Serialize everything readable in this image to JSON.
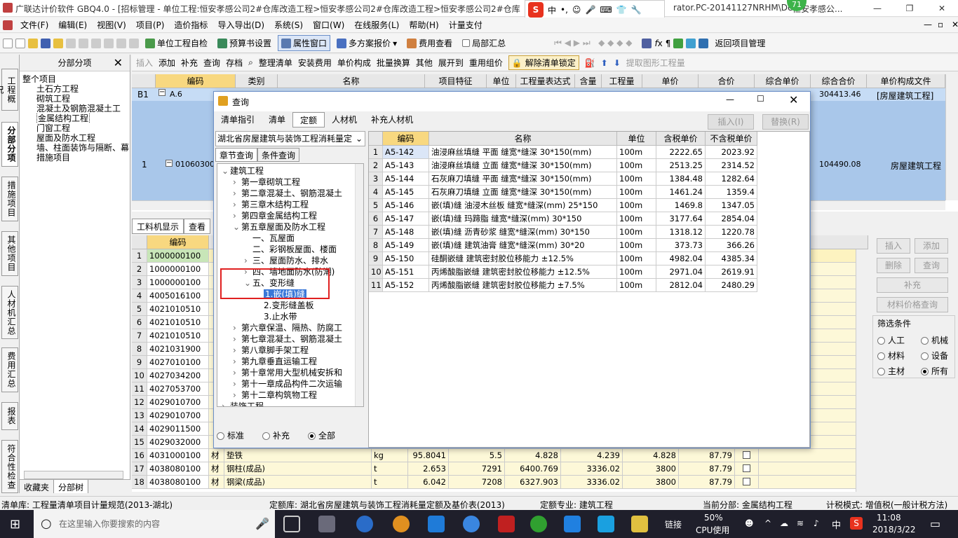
{
  "window": {
    "title": "广联达计价软件 GBQ4.0 - [招标管理 - 单位工程:恒安孝感公司2#仓库改造工程>恒安孝感公司2#仓库改造工程>恒安孝感公司2#仓库改造",
    "title_tail": "rator.PC-20141127NRHM\\De",
    "title_tail2": "恒安孝感公...",
    "badge": "71"
  },
  "ime": {
    "lang": "中"
  },
  "menu": [
    "文件(F)",
    "编辑(E)",
    "视图(V)",
    "项目(P)",
    "造价指标",
    "导入导出(D)",
    "系统(S)",
    "窗口(W)",
    "在线服务(L)",
    "帮助(H)",
    "计量支付"
  ],
  "toolbar1": [
    "单位工程自检",
    "预算书设置",
    "属性窗口",
    "多方案报价",
    "费用查看",
    "局部汇总",
    "返回项目管理"
  ],
  "toolbar2": [
    "插入",
    "添加",
    "补充",
    "查询",
    "存档",
    "整理清单",
    "安装费用",
    "单价构成",
    "批量换算",
    "其他",
    "展开到",
    "重用组价",
    "解除清单锁定",
    "提取图形工程量"
  ],
  "lefttabs": [
    "工程概况",
    "分部分项",
    "措施项目",
    "其他项目",
    "人材机汇总",
    "费用汇总",
    "报表",
    "符合性检查"
  ],
  "nav": {
    "title": "分部分项",
    "items": [
      "整个项目",
      "土石方工程",
      "砌筑工程",
      "混凝土及钢筋混凝土工",
      "金属结构工程",
      "门窗工程",
      "屋面及防水工程",
      "墙、柱面装饰与隔断、幕",
      "措施项目"
    ],
    "bottom": [
      "收藏夹",
      "分部树"
    ]
  },
  "grid1": {
    "headers": [
      "编码",
      "类别",
      "名称",
      "项目特征",
      "单位",
      "工程量表达式",
      "含量",
      "工程量",
      "单价",
      "合价",
      "综合单价",
      "综合合价",
      "单价构成文件"
    ],
    "rows": [
      {
        "num": "B1",
        "code": "A.6",
        "total": "304413.46",
        "file": "[房屋建筑工程]"
      },
      {
        "num": "1",
        "code": "01060300",
        "total": "104490.08",
        "file": "房屋建筑工程"
      }
    ]
  },
  "midtabs": [
    "工料机显示",
    "查看"
  ],
  "grid2": {
    "header_code": "编码",
    "rows": [
      {
        "n": "1",
        "code": "1000000100"
      },
      {
        "n": "2",
        "code": "1000000100"
      },
      {
        "n": "3",
        "code": "1000000100"
      },
      {
        "n": "4",
        "code": "4005016100"
      },
      {
        "n": "5",
        "code": "4021010510"
      },
      {
        "n": "6",
        "code": "4021010510"
      },
      {
        "n": "7",
        "code": "4021010510"
      },
      {
        "n": "8",
        "code": "4021031900"
      },
      {
        "n": "9",
        "code": "4027010100"
      },
      {
        "n": "10",
        "code": "4027034200"
      },
      {
        "n": "11",
        "code": "4027053700"
      },
      {
        "n": "12",
        "code": "4029010700"
      },
      {
        "n": "13",
        "code": "4029010700"
      },
      {
        "n": "14",
        "code": "4029011500"
      },
      {
        "n": "15",
        "code": "4029032000"
      },
      {
        "n": "16",
        "code": "4031000100",
        "cat": "材",
        "name": "垫铁",
        "unit": "kg",
        "q": "95.8041",
        "p1": "5.5",
        "p2": "4.828",
        "p3": "4.239",
        "p4": "4.828",
        "p5": "87.79"
      },
      {
        "n": "17",
        "code": "4038080100",
        "cat": "材",
        "name": "钢柱(成品)",
        "unit": "t",
        "q": "2.653",
        "p1": "7291",
        "p2": "6400.769",
        "p3": "3336.02",
        "p4": "3800",
        "p5": "87.79"
      },
      {
        "n": "18",
        "code": "4038080100",
        "cat": "材",
        "name": "钢梁(成品)",
        "unit": "t",
        "q": "6.042",
        "p1": "7208",
        "p2": "6327.903",
        "p3": "3336.02",
        "p4": "3800",
        "p5": "87.79"
      }
    ]
  },
  "rightpanel": {
    "buttons": [
      "插入",
      "添加",
      "删除",
      "查询",
      "补充",
      "材料价格查询"
    ],
    "filter_title": "筛选条件",
    "filters": [
      "人工",
      "机械",
      "材料",
      "设备",
      "主材",
      "所有"
    ]
  },
  "dialog": {
    "title": "查询",
    "tabs": [
      "清单指引",
      "清单",
      "定额",
      "人材机",
      "补充人材机"
    ],
    "btn_insert": "插入(I)",
    "btn_replace": "替换(R)",
    "library": "湖北省房屋建筑与装饰工程消耗量定",
    "subtabs": [
      "章节查询",
      "条件查询"
    ],
    "tree": [
      "建筑工程",
      "第一章砌筑工程",
      "第二章混凝土、钢筋混凝土",
      "第三章木结构工程",
      "第四章金属结构工程",
      "第五章屋面及防水工程",
      "一、瓦屋面",
      "二、彩钢板屋面、楼面",
      "三、屋面防水、排水",
      "四、墙地面防水(防潮)",
      "五、变形缝",
      "1.嵌(填)缝",
      "2.变形缝盖板",
      "3.止水带",
      "第六章保温、隔热、防腐工",
      "第七章混凝土、钢筋混凝土",
      "第八章脚手架工程",
      "第九章垂直运输工程",
      "第十章常用大型机械安拆和",
      "第十一章成品构件二次运输",
      "第十二章构筑物工程",
      "装饰工程"
    ],
    "radios": [
      "标准",
      "补充",
      "全部"
    ],
    "headers": [
      "编码",
      "名称",
      "单位",
      "含税单价",
      "不含税单价"
    ],
    "rows": [
      {
        "n": "1",
        "code": "A5-142",
        "name": "油浸麻丝填缝 平面 缝宽*缝深 30*150(mm)",
        "unit": "100m",
        "p1": "2222.65",
        "p2": "2023.92"
      },
      {
        "n": "2",
        "code": "A5-143",
        "name": "油浸麻丝填缝 立面 缝宽*缝深 30*150(mm)",
        "unit": "100m",
        "p1": "2513.25",
        "p2": "2314.52"
      },
      {
        "n": "3",
        "code": "A5-144",
        "name": "石灰麻刀填缝 平面 缝宽*缝深 30*150(mm)",
        "unit": "100m",
        "p1": "1384.48",
        "p2": "1282.64"
      },
      {
        "n": "4",
        "code": "A5-145",
        "name": "石灰麻刀填缝 立面 缝宽*缝深 30*150(mm)",
        "unit": "100m",
        "p1": "1461.24",
        "p2": "1359.4"
      },
      {
        "n": "5",
        "code": "A5-146",
        "name": "嵌(填)缝 油浸木丝板 缝宽*缝深(mm) 25*150",
        "unit": "100m",
        "p1": "1469.8",
        "p2": "1347.05"
      },
      {
        "n": "6",
        "code": "A5-147",
        "name": "嵌(填)缝 玛蹄脂 缝宽*缝深(mm) 30*150",
        "unit": "100m",
        "p1": "3177.64",
        "p2": "2854.04"
      },
      {
        "n": "7",
        "code": "A5-148",
        "name": "嵌(填)缝 沥青砂浆 缝宽*缝深(mm) 30*150",
        "unit": "100m",
        "p1": "1318.12",
        "p2": "1220.78"
      },
      {
        "n": "8",
        "code": "A5-149",
        "name": "嵌(填)缝 建筑油膏 缝宽*缝深(mm) 30*20",
        "unit": "100m",
        "p1": "373.73",
        "p2": "366.26"
      },
      {
        "n": "9",
        "code": "A5-150",
        "name": "硅酮嵌缝 建筑密封胶位移能力 ±12.5%",
        "unit": "100m",
        "p1": "4982.04",
        "p2": "4385.34"
      },
      {
        "n": "10",
        "code": "A5-151",
        "name": "丙烯酸脂嵌缝 建筑密封胶位移能力 ±12.5%",
        "unit": "100m",
        "p1": "2971.04",
        "p2": "2619.91"
      },
      {
        "n": "11",
        "code": "A5-152",
        "name": "丙烯酸脂嵌缝 建筑密封胶位移能力 ±7.5%",
        "unit": "100m",
        "p1": "2812.04",
        "p2": "2480.29"
      }
    ]
  },
  "status": {
    "s1": "清单库: 工程量清单项目计量规范(2013-湖北)",
    "s2": "定额库: 湖北省房屋建筑与装饰工程消耗量定额及基价表(2013)",
    "s3": "定额专业: 建筑工程",
    "s4": "当前分部: 金属结构工程",
    "s5": "计税模式: 增值税(一般计税方法)"
  },
  "taskbar": {
    "search": "在这里输入你要搜索的内容",
    "link": "链接",
    "cpu": "50%",
    "cpu_label": "CPU使用",
    "ime": "中",
    "time": "11:08",
    "date": "2018/3/22"
  }
}
